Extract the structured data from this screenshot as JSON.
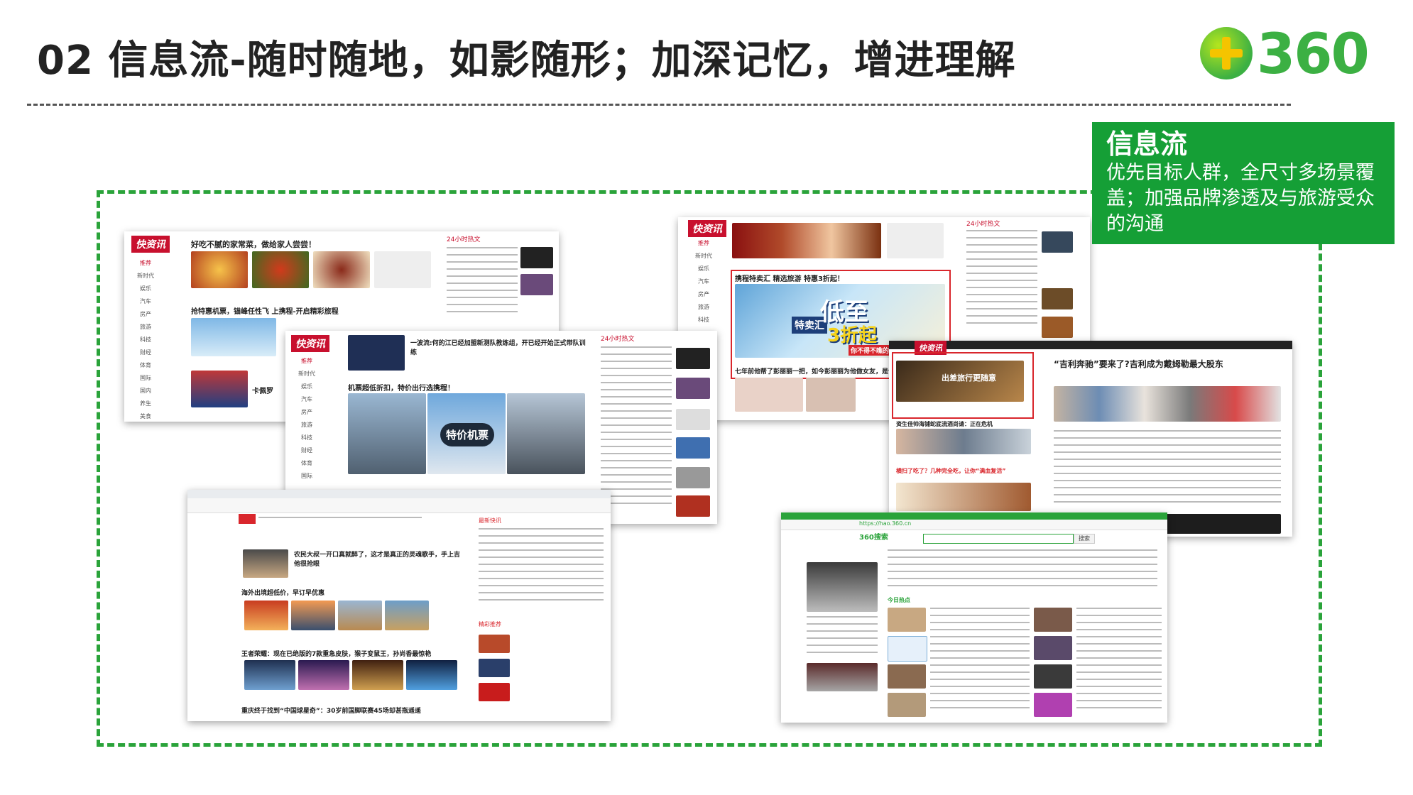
{
  "slide": {
    "title": "02 信息流-随时随地，如影随形；加深记忆，增进理解",
    "logo_text": "360",
    "callout": {
      "heading": "信息流",
      "body": "优先目标人群，全尺寸多场景覆盖；加强品牌渗透及与旅游受众的沟通"
    }
  },
  "shots": {
    "brand": "快资讯",
    "hot24": "24小时热文",
    "side": [
      "推荐",
      "新时代",
      "娱乐",
      "汽车",
      "房产",
      "旅游",
      "科技",
      "财经",
      "体育",
      "国际",
      "国内",
      "养生",
      "美食"
    ],
    "s1": {
      "head": "好吃不腻的家常菜，做给家人尝尝！",
      "head2": "抢特惠机票，锚峰任性飞 上携程-开启精彩旅程",
      "ad": "卡佩罗"
    },
    "s2": {
      "head": "一波流:何的江已经加盟新测队教练组，开已经开始正式带队训练",
      "head2": "机票超低折扣，特价出行选携程！",
      "ad_text": "特价机票"
    },
    "s3": {
      "head": "携程特卖汇 精选旅游 特惠3折起！",
      "ad_main": "低至",
      "ad_sub": "3折起",
      "ad_tag": "特卖汇",
      "ad_small": "你不得不瞧的",
      "foot": "七年前他帮了彭丽丽一把，如今彭丽丽为他做女友，是谁"
    },
    "s4": {
      "head": "“吉利奔驰”要来了?吉利成为戴姆勒最大股东",
      "ad": "出差旅行更随意",
      "foot1": "资生佳帅海铺蛇底流酒尚请：正在危机",
      "foot2": "横扫了吃了？几种完全吃，让你“满血复活”"
    },
    "s5": {
      "head": "农民大叔一开口真就醉了，这才是真正的灵魂歌手，手上吉他很抢眼",
      "head2": "海外出境超低价，早订早优惠",
      "head3": "王者荣耀：现在已绝版的7款重急皮肤，猴子变鼠王，孙尚香最惊艳",
      "head4": "重庆终于找到“中国球星奇”：30岁前国脚联赛45场却甚瓶遥遥",
      "side_title": "最新快讯",
      "side_title2": "精彩推荐"
    },
    "s6": {
      "search_label": "360搜索",
      "search_btn": "搜索",
      "address": "https://hao.360.cn",
      "section": "今日热点"
    }
  }
}
